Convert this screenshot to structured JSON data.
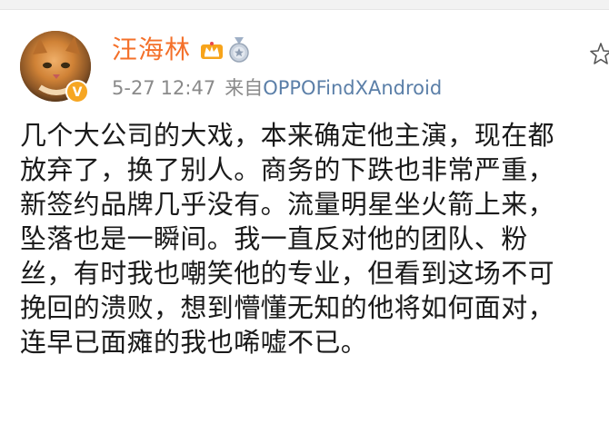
{
  "post": {
    "author": {
      "name": "汪海林",
      "avatar_icon": "cat-avatar",
      "verified_icon": "verified-badge-icon",
      "badges": [
        "vip-crown-icon",
        "medal-icon"
      ]
    },
    "meta": {
      "date": "5-27",
      "time": "12:47",
      "from_label": "来自",
      "source": "OPPOFindXAndroid"
    },
    "body_lines": [
      "几个大公司的大戏，本来确定他主演，现在都",
      "放弃了，换了别人。商务的下跌也非常严重，",
      "新签约品牌几乎没有。流量明星坐火箭上来，",
      "坠落也是一瞬间。我一直反对他的团队、粉",
      "丝，有时我也嘲笑他的专业，但看到这场不可",
      "挽回的溃败，想到懵懂无知的他将如何面对，",
      "连早已面瘫的我也唏嘘不已。"
    ]
  },
  "colors": {
    "username": "#f4702a",
    "meta": "#8a8a8a",
    "source_link": "#5b7fa8",
    "body_text": "#1a1a1a",
    "verified_badge": "#f6a623"
  }
}
